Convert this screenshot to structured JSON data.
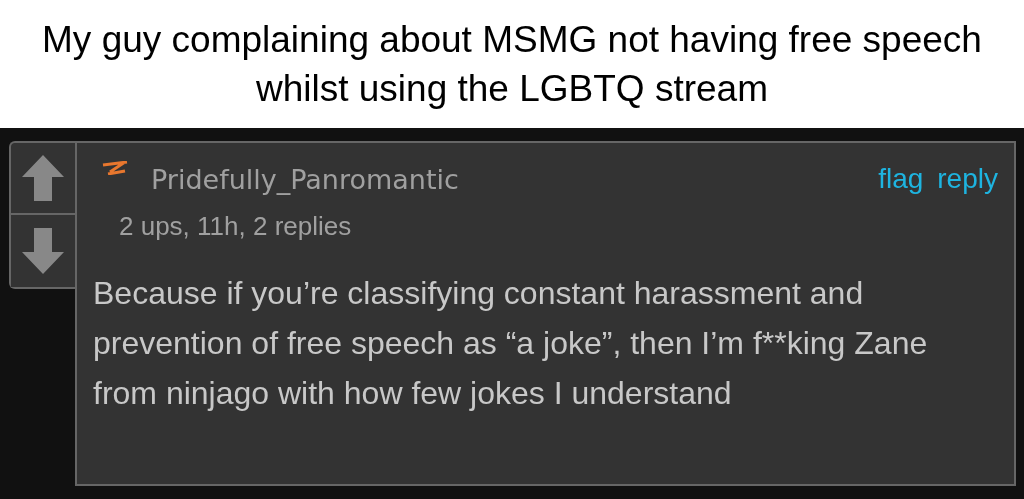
{
  "caption": "My guy complaining about MSMG not having free speech whilst using the LGBTQ stream",
  "comment": {
    "username": "Pridefully_Panromantic",
    "meta": "2 ups, 11h, 2 replies",
    "actions": [
      "flag",
      "reply"
    ],
    "body": "Because if you’re classifying constant harassment and prevention of free speech as “a joke”, then I’m f**king Zane from ninjago with how few jokes I understand"
  }
}
